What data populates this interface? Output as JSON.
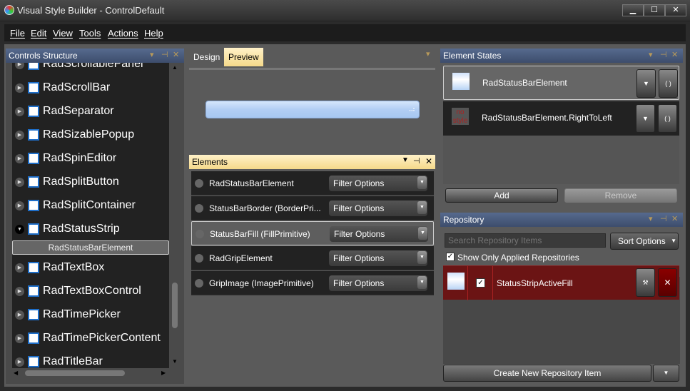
{
  "window": {
    "title": "Visual Style Builder - ControlDefault",
    "minimize": "▁",
    "maximize": "☐",
    "close": "✕"
  },
  "menu": [
    "File",
    "Edit",
    "View",
    "Tools",
    "Actions",
    "Help"
  ],
  "controls_structure": {
    "title": "Controls Structure",
    "items": [
      {
        "label": "RadScrollablePanel"
      },
      {
        "label": "RadScrollBar"
      },
      {
        "label": "RadSeparator"
      },
      {
        "label": "RadSizablePopup"
      },
      {
        "label": "RadSpinEditor"
      },
      {
        "label": "RadSplitButton"
      },
      {
        "label": "RadSplitContainer"
      },
      {
        "label": "RadStatusStrip",
        "expanded": true
      }
    ],
    "selected_child": "RadStatusBarElement",
    "items_after": [
      {
        "label": "RadTextBox"
      },
      {
        "label": "RadTextBoxControl"
      },
      {
        "label": "RadTimePicker"
      },
      {
        "label": "RadTimePickerContent"
      },
      {
        "label": "RadTitleBar"
      }
    ]
  },
  "tabs": {
    "design": "Design",
    "preview": "Preview",
    "active": "Preview"
  },
  "elements": {
    "title": "Elements",
    "filter_label": "Filter Options",
    "rows": [
      "RadStatusBarElement",
      "StatusBarBorder  (BorderPri...",
      "StatusBarFill (FillPrimitive)",
      "RadGripElement",
      "GripImage (ImagePrimitive)"
    ],
    "selected_index": 2
  },
  "element_states": {
    "title": "Element States",
    "rows": [
      "RadStatusBarElement",
      "RadStatusBarElement.RightToLeft"
    ],
    "no_style_text": "no style",
    "add": "Add",
    "remove": "Remove"
  },
  "repository": {
    "title": "Repository",
    "search_placeholder": "Search Repository Items",
    "sort": "Sort Options",
    "show_only_applied": "Show Only Applied Repositories",
    "show_only_applied_checked": true,
    "items": [
      {
        "name": "StatusStripActiveFill",
        "checked": true
      }
    ],
    "create": "Create New Repository Item"
  },
  "colors": {
    "panel_header": "#4a5a7a",
    "accent_yellow": "#f5d98a",
    "repo_selected": "#6b1414"
  }
}
